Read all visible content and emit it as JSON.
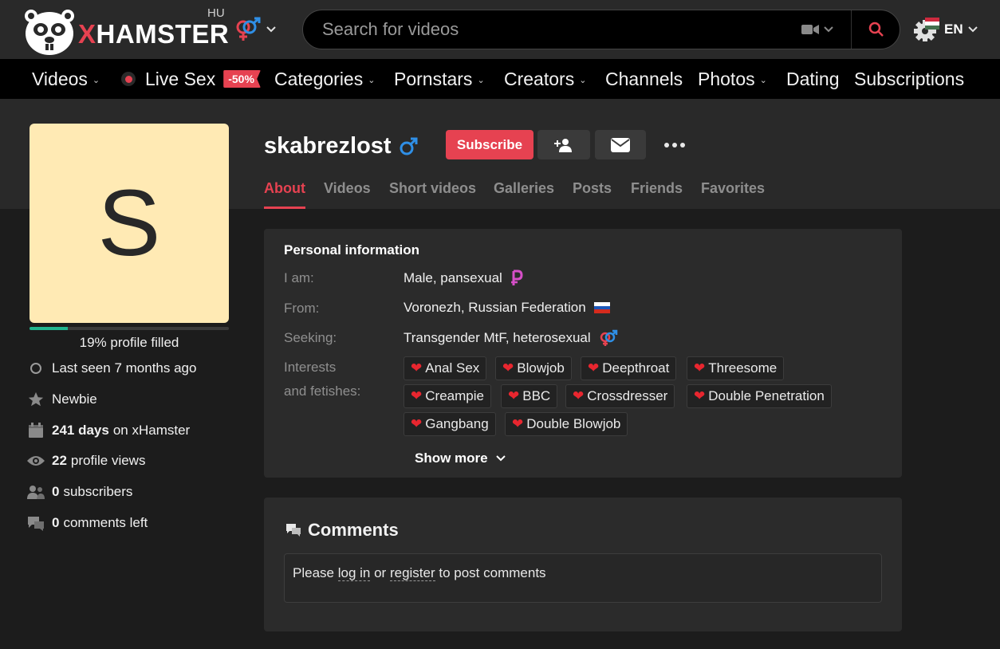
{
  "header": {
    "logo_text_x": "X",
    "logo_text_rest": "HAMSTER",
    "region": "HU",
    "search_placeholder": "Search for videos",
    "language": "EN"
  },
  "nav": {
    "videos": "Videos",
    "live_sex": "Live Sex",
    "live_promo": "-50%",
    "categories": "Categories",
    "pornstars": "Pornstars",
    "creators": "Creators",
    "channels": "Channels",
    "photos": "Photos",
    "dating": "Dating",
    "subscriptions": "Subscriptions"
  },
  "profile": {
    "avatar_letter": "S",
    "username": "skabrezlost",
    "profile_filled_fraction": 0.19,
    "profile_filled_label": "19% profile filled",
    "actions": {
      "subscribe": "Subscribe"
    },
    "stats": {
      "last_seen": "Last seen 7 months ago",
      "rank": "Newbie",
      "days_count": "241 days",
      "days_suffix": "on xHamster",
      "views_count": "22",
      "views_suffix": "profile views",
      "subscribers_count": "0",
      "subscribers_suffix": "subscribers",
      "comments_count": "0",
      "comments_suffix": "comments left"
    },
    "tabs": [
      "About",
      "Videos",
      "Short videos",
      "Galleries",
      "Posts",
      "Friends",
      "Favorites"
    ]
  },
  "personal_info": {
    "title": "Personal information",
    "i_am_label": "I am:",
    "i_am_value": "Male, pansexual",
    "from_label": "From:",
    "from_value": "Voronezh, Russian Federation",
    "seeking_label": "Seeking:",
    "seeking_value": "Transgender MtF, heterosexual",
    "interests_label_1": "Interests",
    "interests_label_2": "and fetishes:",
    "interests": [
      "Anal Sex",
      "Blowjob",
      "Deepthroat",
      "Threesome",
      "Creampie",
      "BBC",
      "Crossdresser",
      "Double Penetration",
      "Gangbang",
      "Double Blowjob"
    ],
    "show_more": "Show more"
  },
  "comments": {
    "title": "Comments",
    "prompt_1": "Please",
    "log_in": "log in",
    "prompt_2": "or",
    "register": "register",
    "prompt_3": "to post comments"
  },
  "colors": {
    "accent": "#e64251",
    "male_blue": "#2f8fe6",
    "progress": "#1fb58f",
    "pansexual_pink": "#d64fc8"
  }
}
